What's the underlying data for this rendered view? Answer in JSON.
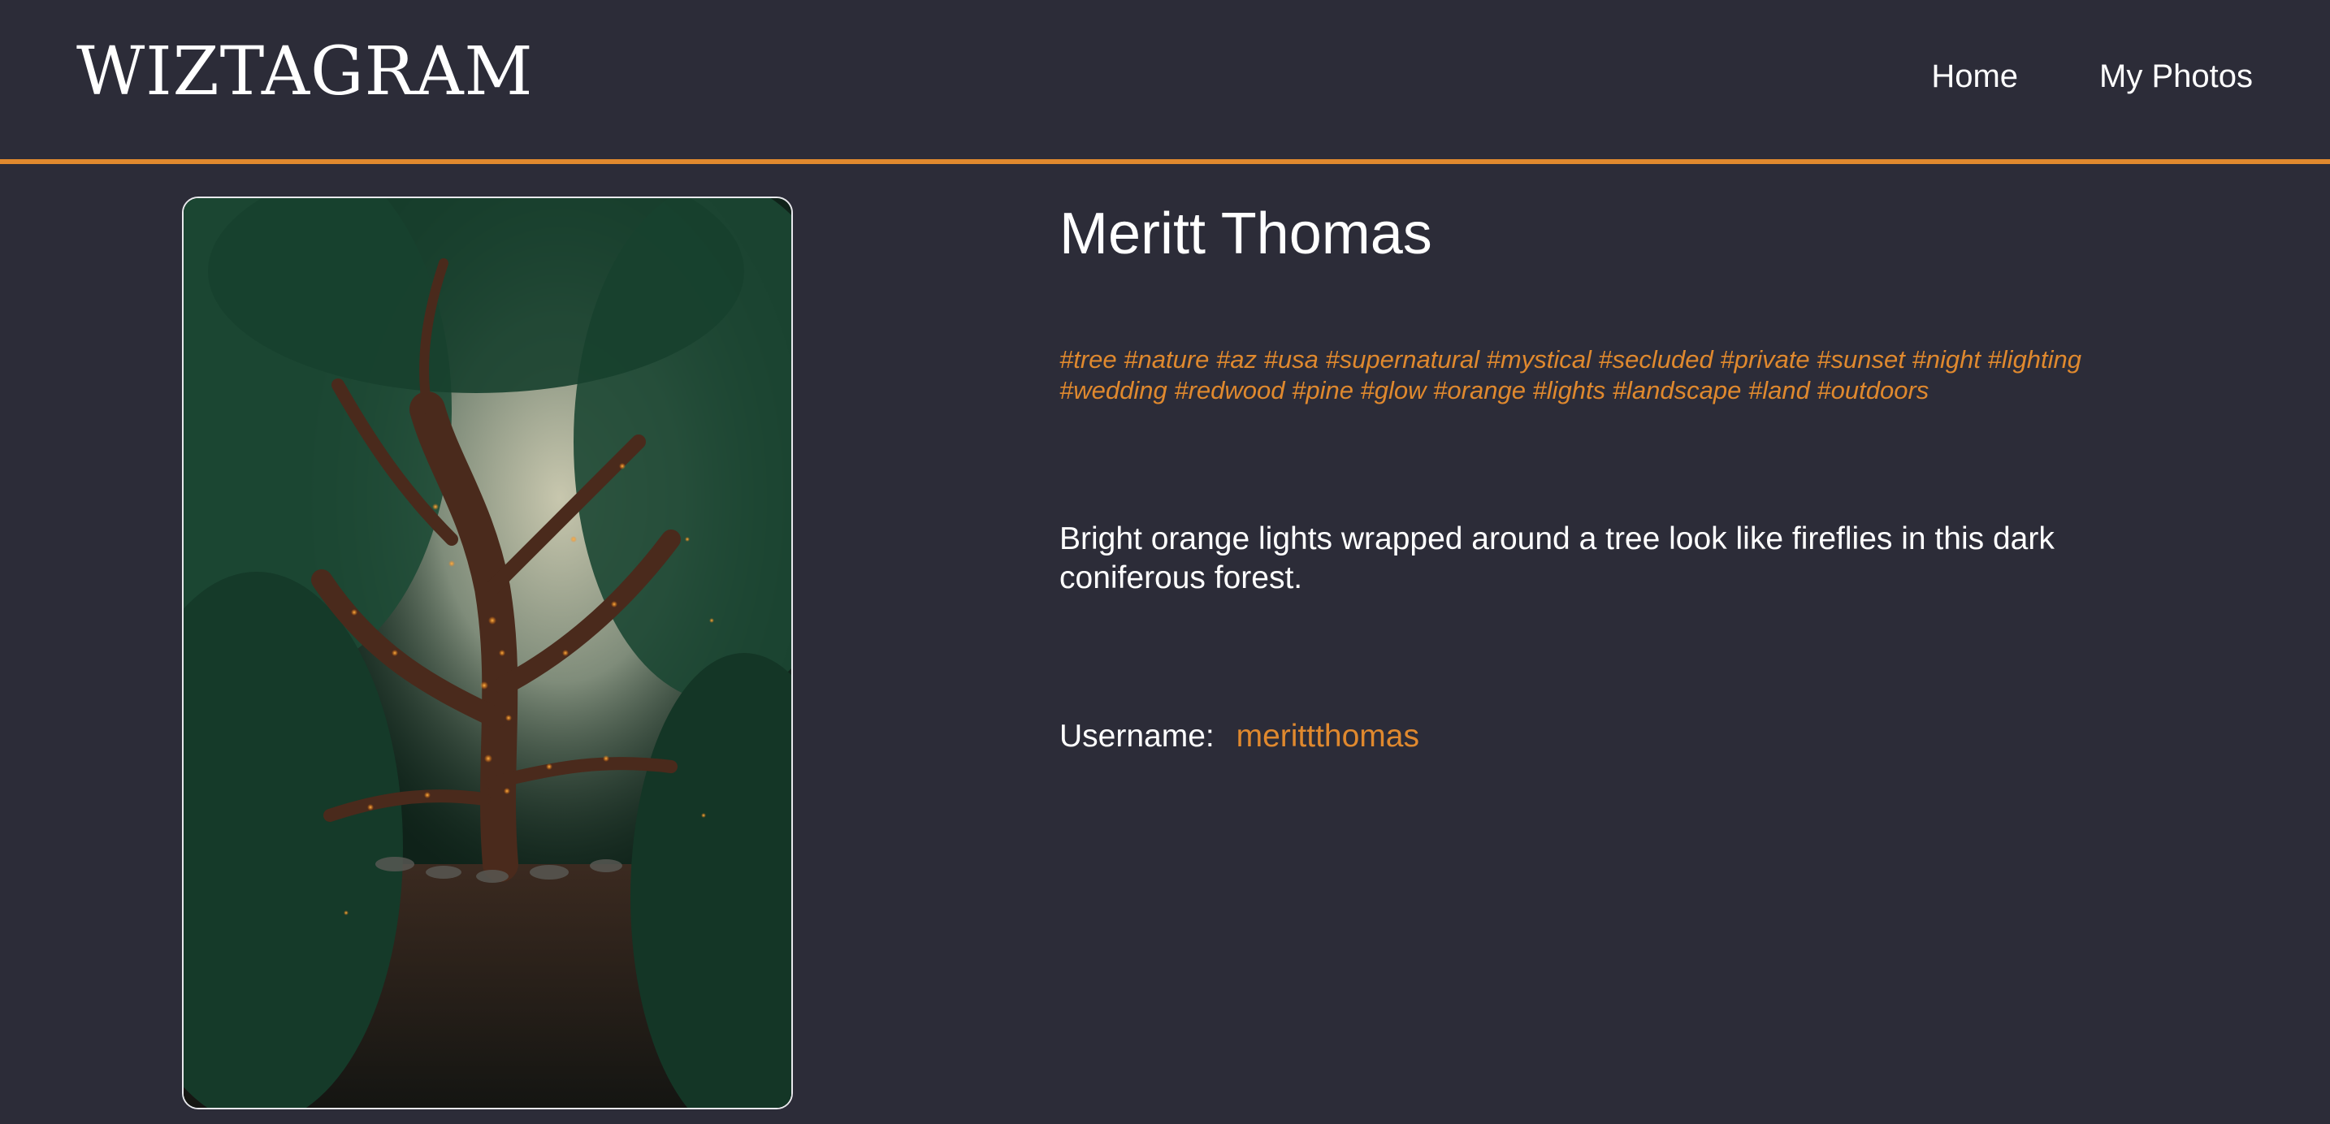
{
  "header": {
    "logo_text": "WIZTAGRAM",
    "nav": [
      {
        "label": "Home"
      },
      {
        "label": "My Photos"
      }
    ]
  },
  "photo": {
    "icon": "photo-image"
  },
  "details": {
    "title": "Meritt Thomas",
    "tags": "#tree #nature #az #usa #supernatural #mystical #secluded #private #sunset #night #lighting #wedding #redwood #pine #glow #orange #lights #landscape #land #outdoors",
    "description": "Bright orange lights wrapped around a tree look like fireflies in this dark coniferous forest.",
    "username_label": "Username:",
    "username_value": "merittthomas"
  },
  "colors": {
    "background": "#2c2c38",
    "accent": "#e0892e",
    "text": "#ffffff"
  }
}
